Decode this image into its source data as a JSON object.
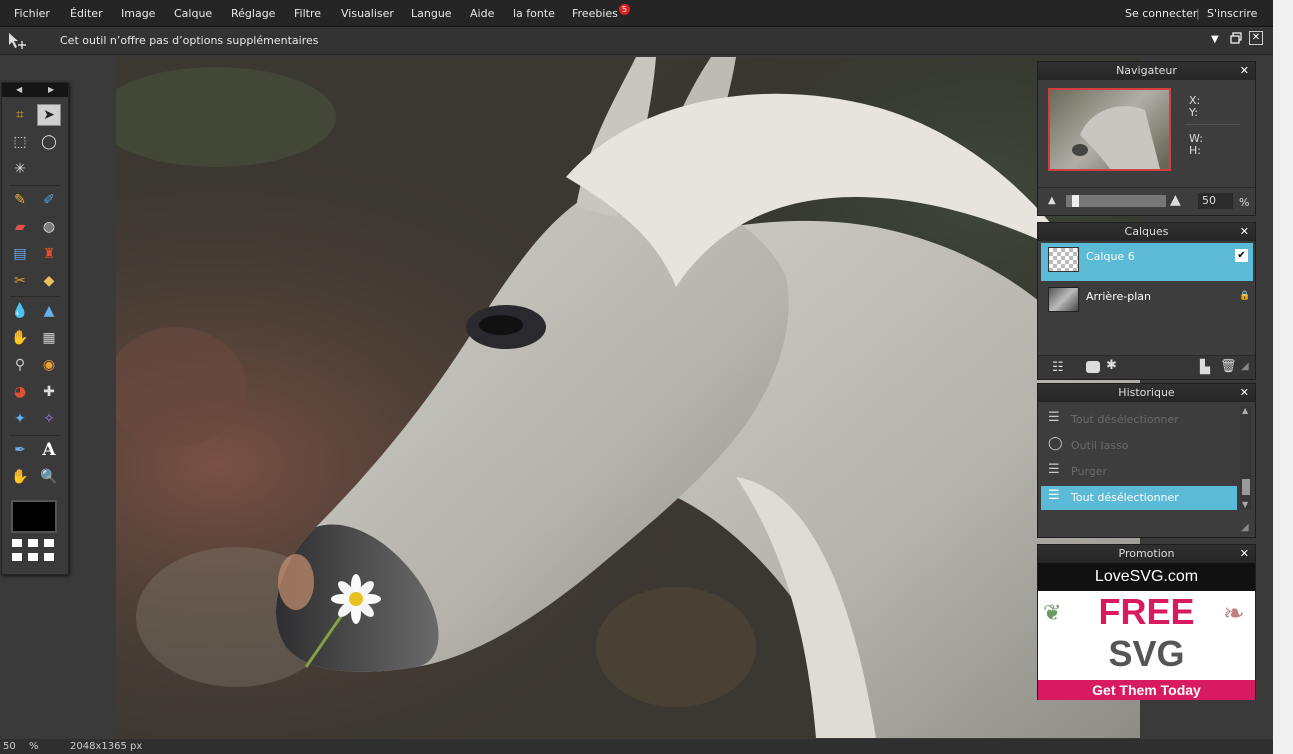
{
  "menu": {
    "items": [
      "Fichier",
      "Éditer",
      "Image",
      "Calque",
      "Réglage",
      "Filtre",
      "Visualiser",
      "Langue",
      "Aide",
      "la fonte",
      "Freebies"
    ],
    "freebies_badge": "5",
    "login": "Se connecter",
    "separator": "|",
    "signup": "S'inscrire"
  },
  "options": {
    "hint": "Cet outil n’offre pas d’options supplémentaires"
  },
  "navigator": {
    "title": "Navigateur",
    "x_label": "X:",
    "y_label": "Y:",
    "w_label": "W:",
    "h_label": "H:",
    "zoom_value": "50",
    "zoom_unit": "%",
    "zoom_slider_level": 0.06
  },
  "layers": {
    "title": "Calques",
    "items": [
      {
        "name": "Calque 6",
        "selected": true,
        "visible_check": "✔"
      },
      {
        "name": "Arrière-plan",
        "selected": false
      }
    ]
  },
  "history": {
    "title": "Historique",
    "items": [
      {
        "label": "Tout désélectionner",
        "icon": "deselect-icon",
        "active": false
      },
      {
        "label": "Outil lasso",
        "icon": "lasso-icon",
        "active": false
      },
      {
        "label": "Purger",
        "icon": "deselect-icon",
        "active": false
      },
      {
        "label": "Tout désélectionner",
        "icon": "deselect-icon",
        "active": true
      }
    ]
  },
  "promotion": {
    "title": "Promotion",
    "brand": "LoveSVG.com",
    "line1": "FREE",
    "line2": "SVG",
    "cta": "Get Them Today"
  },
  "status": {
    "zoom": "50",
    "unit": "%",
    "size": "2048x1365 px"
  },
  "colors": {
    "accent": "#5bbad5",
    "promo_pink": "#d81b60"
  }
}
